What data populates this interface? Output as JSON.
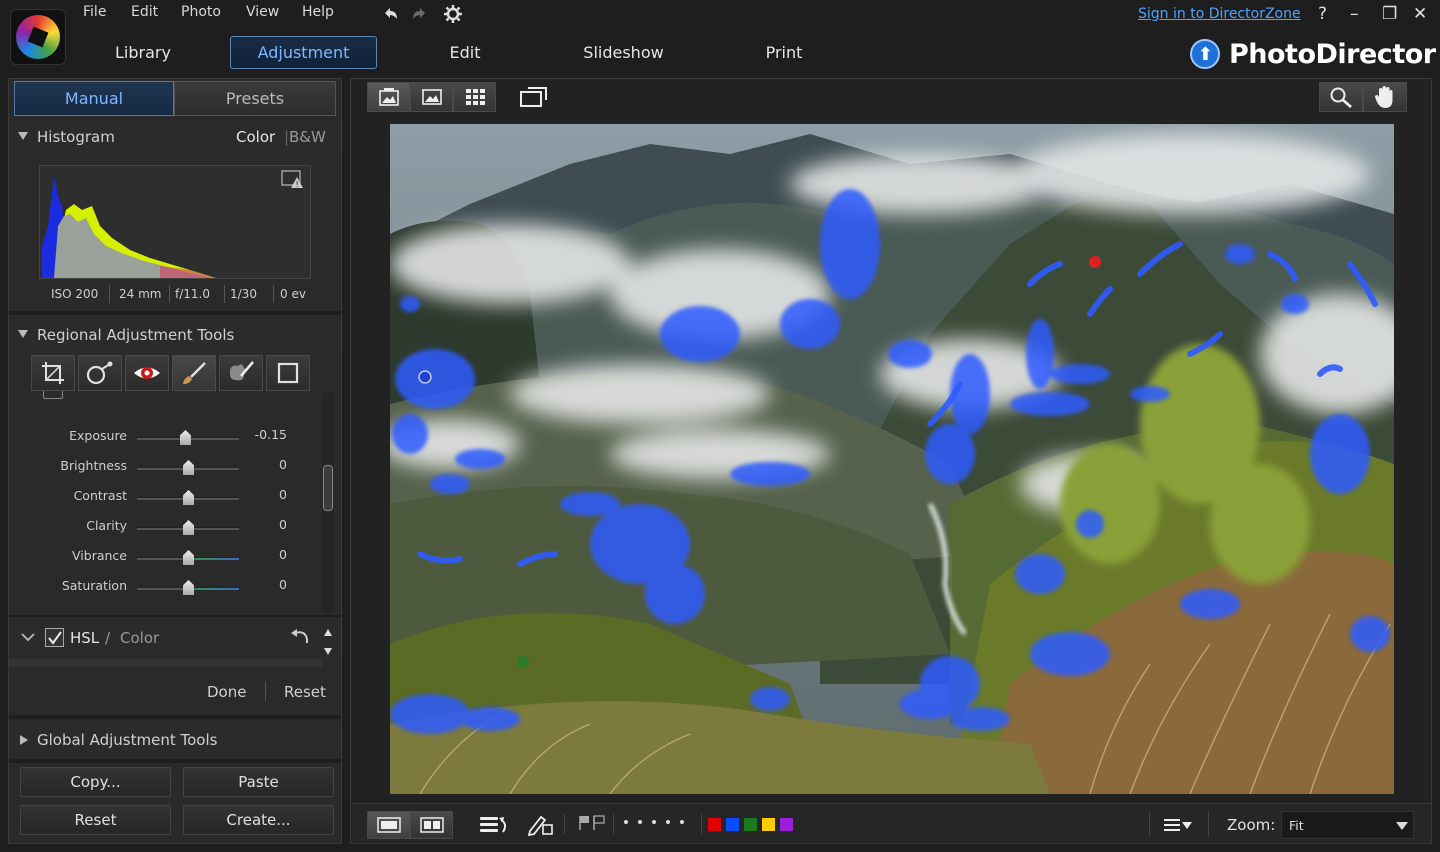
{
  "menu": {
    "file": "File",
    "edit": "Edit",
    "photo": "Photo",
    "view": "View",
    "help": "Help"
  },
  "modes": {
    "library": "Library",
    "adjustment": "Adjustment",
    "edit": "Edit",
    "slideshow": "Slideshow",
    "print": "Print"
  },
  "account": {
    "signin": "Sign in to DirectorZone"
  },
  "window": {
    "help": "?",
    "minimize": "–",
    "restore": "❐",
    "close": "✕"
  },
  "brand": {
    "name": "PhotoDirector"
  },
  "panel_tabs": {
    "manual": "Manual",
    "presets": "Presets"
  },
  "histogram": {
    "title": "Histogram",
    "color": "Color",
    "separator": "|",
    "bw": "B&W",
    "exif": {
      "iso": "ISO 200",
      "focal": "24 mm",
      "aperture": "f/11.0",
      "shutter": "1/30",
      "ev": "0 ev"
    }
  },
  "regional": {
    "title": "Regional Adjustment Tools"
  },
  "sliders": [
    {
      "label": "Exposure",
      "value": "-0.15",
      "level": 0.47
    },
    {
      "label": "Brightness",
      "value": "0",
      "level": 0.5
    },
    {
      "label": "Contrast",
      "value": "0",
      "level": 0.5
    },
    {
      "label": "Clarity",
      "value": "0",
      "level": 0.5
    },
    {
      "label": "Vibrance",
      "value": "0",
      "level": 0.5
    },
    {
      "label": "Saturation",
      "value": "0",
      "level": 0.5
    }
  ],
  "hsl": {
    "label": "HSL",
    "slash": "/",
    "color": "Color"
  },
  "actions": {
    "done": "Done",
    "reset": "Reset"
  },
  "global": {
    "title": "Global Adjustment Tools"
  },
  "bottom_buttons": {
    "copy": "Copy...",
    "paste": "Paste",
    "reset": "Reset",
    "create": "Create..."
  },
  "viewer": {
    "zoom_label": "Zoom:",
    "zoom_value": "Fit"
  },
  "label_colors": [
    "#e00000",
    "#0a4cff",
    "#1b7a1b",
    "#ffcc00",
    "#9a1fd6"
  ],
  "colors": {
    "accent": "#7eb8ff",
    "brush_mask": "#2f5bff"
  }
}
